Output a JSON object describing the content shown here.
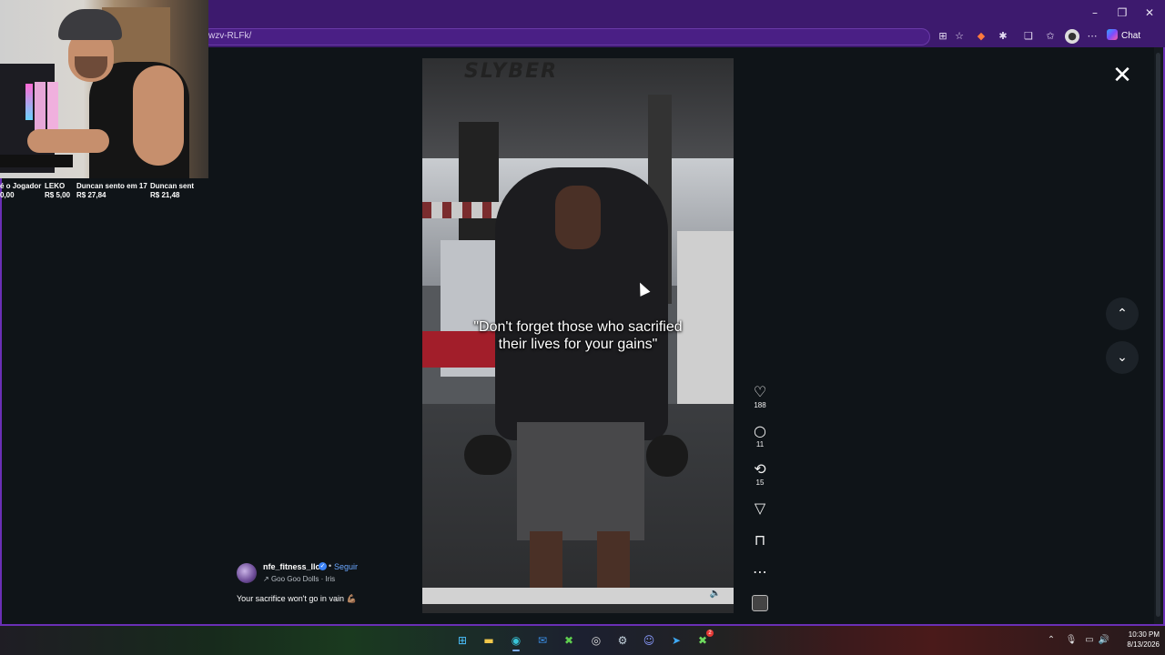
{
  "browser": {
    "url": "wzv-RLFk/",
    "chat_label": "Chat",
    "window_controls": {
      "minimize": "–",
      "restore": "❐",
      "close": "✕"
    },
    "toolbar_icons": [
      "app-available-icon",
      "favorite-star-icon",
      "extension-icon",
      "extension-puzzle-icon",
      "split-screen-icon",
      "favorites-icon",
      "profile-icon",
      "more-icon"
    ]
  },
  "stream_overlay": {
    "donations": [
      {
        "name": "é o Jogador",
        "amount": "0,00"
      },
      {
        "name": "LEKO",
        "amount": "R$ 5,00"
      },
      {
        "name": "Duncan sento em 17",
        "amount": "R$ 27,84"
      },
      {
        "name": "Duncan sent",
        "amount": "R$ 21,48"
      }
    ]
  },
  "reel": {
    "caption_overlay_line1": "\"Don't forget those who sacrified",
    "caption_overlay_line2": "their lives for your gains\"",
    "gym_logo": "SLYBER",
    "likes": "188",
    "comments": "11",
    "reposts": "15",
    "author": {
      "username": "nfe_fitness_llc",
      "follow_label": "Seguir",
      "separator": "•",
      "audio": "Goo Goo Dolls · Iris",
      "caption": "Your sacrifice won't go in vain 💪🏽"
    },
    "close_label": "✕",
    "prev_label": "⌃",
    "next_label": "⌄"
  },
  "taskbar": {
    "time": "10:30 PM",
    "date": "8/13/2026",
    "apps": [
      "windows-start-icon",
      "file-explorer-icon",
      "edge-icon",
      "mail-icon",
      "xbox-icon",
      "obs-icon",
      "steam-icon",
      "discord-icon",
      "telegram-icon",
      "xbox-game-bar-icon"
    ],
    "notification_badge": "2"
  },
  "colors": {
    "browser_frame": "#3d1a6e",
    "page_background": "#0f1418",
    "follow_link": "#6aa7ff",
    "verified_badge": "#3b82f6"
  }
}
